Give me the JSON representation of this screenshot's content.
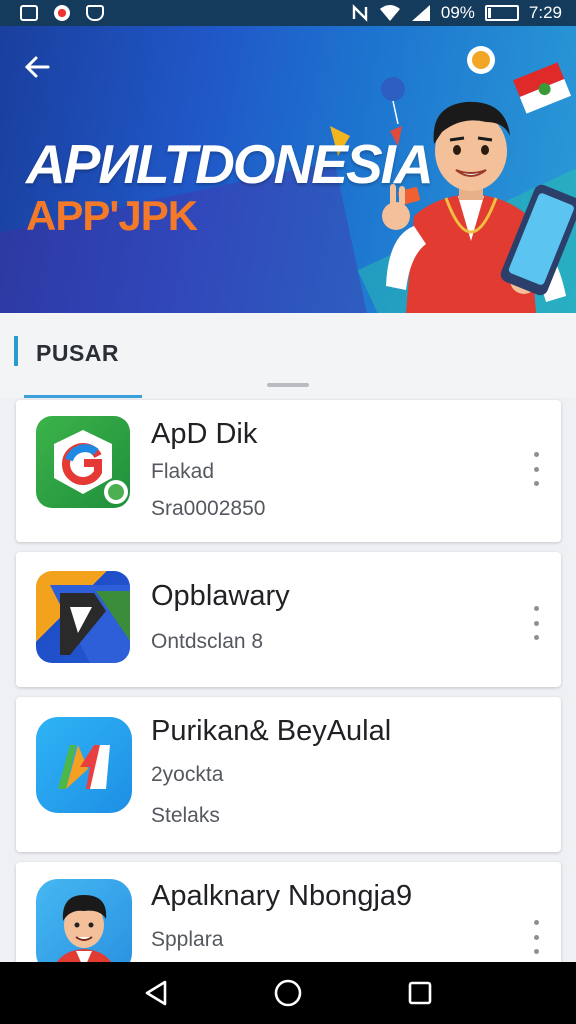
{
  "status_bar": {
    "battery_text": "09%",
    "time": "7:29",
    "battery_level": 0.09
  },
  "banner": {
    "title": "APИLTDONESIA",
    "subtitle": "APP'JPK"
  },
  "section": {
    "title": "PUSAR"
  },
  "apps": [
    {
      "title": "ApD Dik",
      "line1": "Flakad",
      "line2": "Sra0002850",
      "icon": "google-g-icon"
    },
    {
      "title": "Opblawary",
      "line1": "Ontdsclan 8",
      "line2": "",
      "icon": "play-arrow-icon"
    },
    {
      "title": "Purikan& BeyAulal",
      "line1": "2yockta",
      "line2": "Stelaks",
      "icon": "m-letter-icon"
    },
    {
      "title": "Apalknary Nbongja9",
      "line1": "Spplara",
      "line2": "",
      "icon": "avatar-icon"
    }
  ],
  "colors": {
    "status_bar": "#143a5c",
    "accent": "#2b9bd4",
    "banner_subtitle": "#f47a2a"
  }
}
